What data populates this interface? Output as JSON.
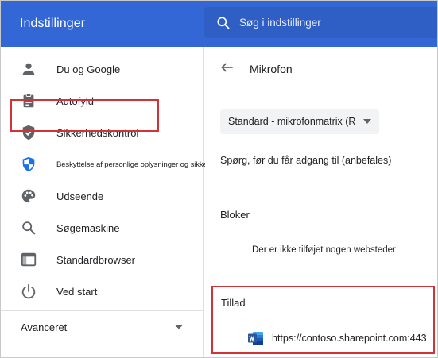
{
  "header": {
    "title": "Indstillinger",
    "search_placeholder": "Søg i indstillinger"
  },
  "sidebar": {
    "items": [
      {
        "label": "Du og Google",
        "icon": "person-icon"
      },
      {
        "label": "Autofyld",
        "icon": "clipboard-icon"
      },
      {
        "label": "Sikkerhedskontrol",
        "icon": "shield-check-icon"
      },
      {
        "label": "Beskyttelse af personlige oplysninger og sikkerhed",
        "icon": "shield-privacy-icon"
      },
      {
        "label": "Udseende",
        "icon": "palette-icon"
      },
      {
        "label": "Søgemaskine",
        "icon": "search-icon"
      },
      {
        "label": "Standardbrowser",
        "icon": "browser-icon"
      },
      {
        "label": "Ved start",
        "icon": "power-icon"
      }
    ],
    "advanced_label": "Avanceret"
  },
  "main": {
    "title": "Mikrofon",
    "device_select_value": "Standard - mikrofonmatrix (R",
    "ask_label": "Spørg, før du får adgang til (anbefales)",
    "block_heading": "Bloker",
    "block_empty": "Der er ikke tilføjet nogen websteder",
    "allow_heading": "Tillad",
    "allow_sites": [
      {
        "url": "https://contoso.sharepoint.com:443",
        "icon": "word-icon"
      }
    ]
  },
  "colors": {
    "header_bg": "#3367d6",
    "icon_gray": "#5f6368",
    "privacy_icon_blue": "#1a73e8",
    "highlight_red": "#d13438",
    "word_blue": "#2b579a"
  }
}
